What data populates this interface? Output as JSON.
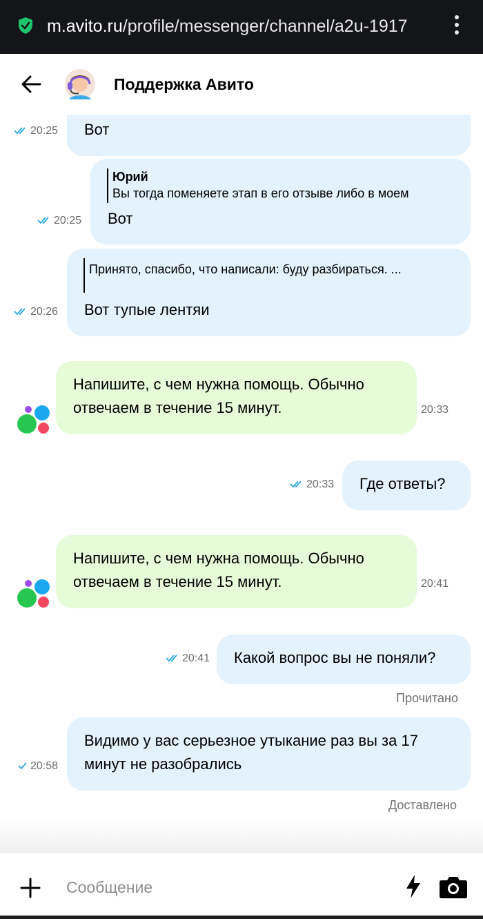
{
  "browser": {
    "url_host": "m.avito.ru",
    "url_path": "/profile/messenger/channel/a2u-1917"
  },
  "header": {
    "title": "Поддержка Авито"
  },
  "messages": [
    {
      "from": "me",
      "text": "Вот",
      "time": "20:25",
      "ticks": "double"
    },
    {
      "from": "me",
      "quote_author": "Юрий",
      "quote_text": "Вы тогда поменяете этап в его отзыве либо в моем",
      "text": "Вот",
      "time": "20:25",
      "ticks": "double"
    },
    {
      "from": "me",
      "quote_text": "Принято, спасибо, что написали: буду разбираться. ...",
      "text": "Вот тупые лентяи",
      "time": "20:26",
      "ticks": "double"
    },
    {
      "from": "bot",
      "line1": "Напишите, с чем нужна помощь. Обычно",
      "line2": "отвечаем в течение 15 минут.",
      "time": "20:33"
    },
    {
      "from": "me",
      "text": "Где ответы?",
      "time": "20:33",
      "ticks": "double"
    },
    {
      "from": "bot",
      "line1": "Напишите, с чем нужна помощь. Обычно",
      "line2": "отвечаем в течение 15 минут.",
      "time": "20:41"
    },
    {
      "from": "me",
      "text": "Какой вопрос вы не поняли?",
      "time": "20:41",
      "ticks": "double",
      "status": "Прочитано"
    },
    {
      "from": "me",
      "line1": "Видимо у вас серьезное утыкание раз вы за 17",
      "line2": "минут не разобрались",
      "time": "20:58",
      "ticks": "single",
      "status": "Доставлено"
    }
  ],
  "composer": {
    "placeholder": "Сообщение"
  },
  "colors": {
    "my_bubble": "#e3f2fd",
    "bot_bubble": "#e6fbd8",
    "tick": "#29a9e0",
    "url_bar": "#141519"
  },
  "icons": [
    "shield-check-icon",
    "kebab-menu-icon",
    "back-arrow-icon",
    "support-agent-avatar",
    "avito-logo-avatar",
    "double-check-icon",
    "single-check-icon",
    "plus-icon",
    "lightning-icon",
    "camera-icon"
  ]
}
